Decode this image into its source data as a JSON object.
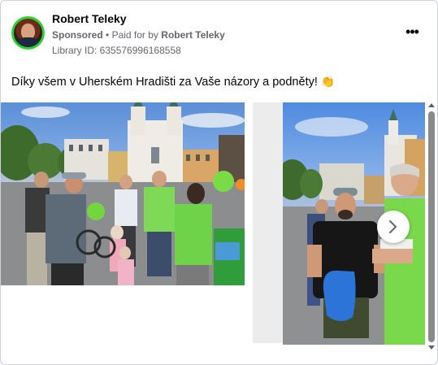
{
  "post": {
    "author": "Robert Teleky",
    "sponsored": "Sponsored",
    "separator": "•",
    "paid_for_prefix": "Paid for by",
    "paid_for_name": "Robert Teleky",
    "library_id": "Library ID: 635576996168558",
    "more_icon": "more-horizontal-icon",
    "more_label": "•••",
    "caption": "Díky všem v Uherském Hradišti za Vaše názory a podněty!",
    "caption_emoji": "👏"
  },
  "carousel": {
    "next_icon": "chevron-right-icon"
  },
  "colors": {
    "avatar_ring": "#2fd12f",
    "secondary_text": "#65676b",
    "primary_text": "#050505"
  }
}
